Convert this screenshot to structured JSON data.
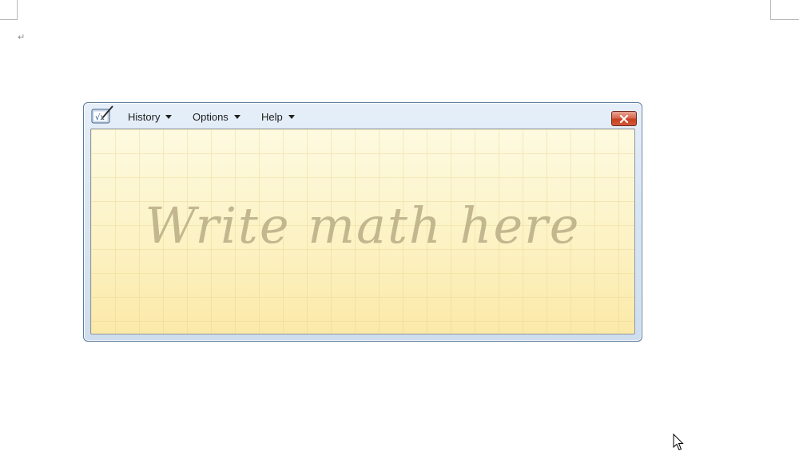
{
  "document": {
    "paragraph_mark": "↵"
  },
  "window": {
    "app_icon": "math-input-panel-icon",
    "menu": [
      {
        "label": "History"
      },
      {
        "label": "Options"
      },
      {
        "label": "Help"
      }
    ],
    "close_icon": "close-icon"
  },
  "writing_area": {
    "hint": "Write math here"
  },
  "colors": {
    "window_frame": "#d9e6f4",
    "writing_background": "#fdf6cd",
    "hint_text": "#b9ad86",
    "close_button": "#c6401f"
  }
}
